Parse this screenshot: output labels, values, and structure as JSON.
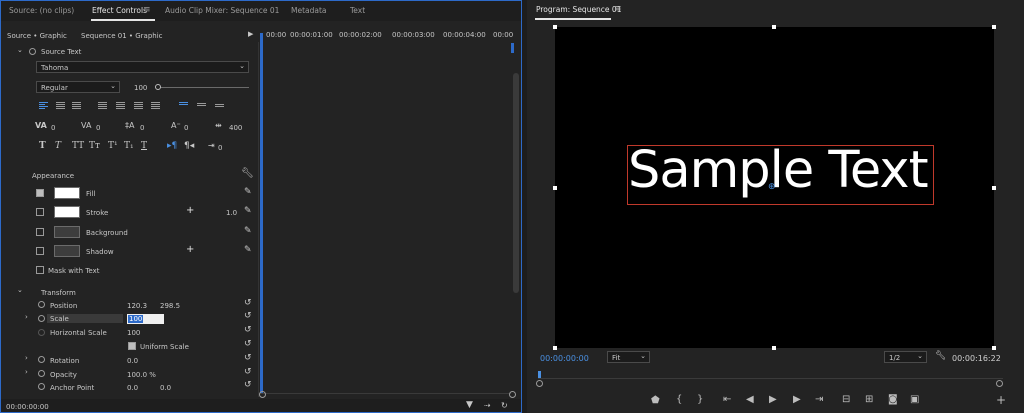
{
  "left_panel": {
    "tabs": [
      "Source: (no clips)",
      "Effect Controls",
      "Audio Clip Mixer: Sequence 01",
      "Metadata",
      "Text"
    ],
    "menu_icon": "hamburger-icon",
    "source_crumb": "Source • Graphic",
    "sequence_crumb": "Sequence 01 • Graphic",
    "timecodes": [
      "00:00",
      "00:00:01:00",
      "00:00:02:00",
      "00:00:03:00",
      "00:00:04:00",
      "00:00"
    ],
    "source_text_label": "Source Text",
    "font_name": "Tahoma",
    "font_style": "Regular",
    "font_size": "100",
    "tracking": "0",
    "kerning": "0",
    "leading": "0",
    "baseline": "0",
    "tsume": "400",
    "style_buttons": [
      "T",
      "T",
      "TT",
      "Tт",
      "T¹",
      "T₁",
      "T"
    ],
    "tab_value": "0",
    "appearance_label": "Appearance",
    "fill_label": "Fill",
    "stroke_label": "Stroke",
    "stroke_width": "1.0",
    "background_label": "Background",
    "shadow_label": "Shadow",
    "mask_label": "Mask with Text",
    "transform_label": "Transform",
    "position_label": "Position",
    "position_x": "120.3",
    "position_y": "298.5",
    "scale_label": "Scale",
    "scale_value": "100",
    "hscale_label": "Horizontal Scale",
    "hscale_value": "100",
    "uniform_label": "Uniform Scale",
    "rotation_label": "Rotation",
    "rotation_value": "0.0",
    "opacity_label": "Opacity",
    "opacity_value": "100.0 %",
    "anchor_label": "Anchor Point",
    "anchor_x": "0.0",
    "anchor_y": "0.0",
    "bottom_timecode": "00:00:00:00"
  },
  "right_panel": {
    "title": "Program: Sequence 01",
    "menu_icon": "hamburger-icon",
    "sample_text": "Sample Text",
    "current_timecode": "00:00:00:00",
    "fit_label": "Fit",
    "resolution": "1/2",
    "duration": "00:00:16:22"
  },
  "colors": {
    "accent": "#4a90e2",
    "panel": "#232323",
    "selection_box": "#c0392b"
  }
}
